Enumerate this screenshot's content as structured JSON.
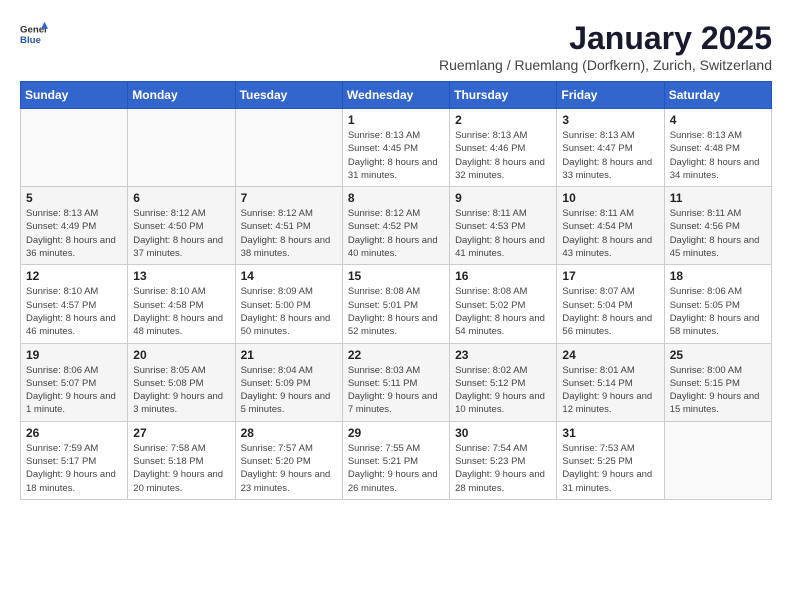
{
  "header": {
    "logo_general": "General",
    "logo_blue": "Blue",
    "title": "January 2025",
    "subtitle": "Ruemlang / Ruemlang (Dorfkern), Zurich, Switzerland"
  },
  "days_of_week": [
    "Sunday",
    "Monday",
    "Tuesday",
    "Wednesday",
    "Thursday",
    "Friday",
    "Saturday"
  ],
  "weeks": [
    [
      {
        "day": "",
        "info": ""
      },
      {
        "day": "",
        "info": ""
      },
      {
        "day": "",
        "info": ""
      },
      {
        "day": "1",
        "info": "Sunrise: 8:13 AM\nSunset: 4:45 PM\nDaylight: 8 hours and 31 minutes."
      },
      {
        "day": "2",
        "info": "Sunrise: 8:13 AM\nSunset: 4:46 PM\nDaylight: 8 hours and 32 minutes."
      },
      {
        "day": "3",
        "info": "Sunrise: 8:13 AM\nSunset: 4:47 PM\nDaylight: 8 hours and 33 minutes."
      },
      {
        "day": "4",
        "info": "Sunrise: 8:13 AM\nSunset: 4:48 PM\nDaylight: 8 hours and 34 minutes."
      }
    ],
    [
      {
        "day": "5",
        "info": "Sunrise: 8:13 AM\nSunset: 4:49 PM\nDaylight: 8 hours and 36 minutes."
      },
      {
        "day": "6",
        "info": "Sunrise: 8:12 AM\nSunset: 4:50 PM\nDaylight: 8 hours and 37 minutes."
      },
      {
        "day": "7",
        "info": "Sunrise: 8:12 AM\nSunset: 4:51 PM\nDaylight: 8 hours and 38 minutes."
      },
      {
        "day": "8",
        "info": "Sunrise: 8:12 AM\nSunset: 4:52 PM\nDaylight: 8 hours and 40 minutes."
      },
      {
        "day": "9",
        "info": "Sunrise: 8:11 AM\nSunset: 4:53 PM\nDaylight: 8 hours and 41 minutes."
      },
      {
        "day": "10",
        "info": "Sunrise: 8:11 AM\nSunset: 4:54 PM\nDaylight: 8 hours and 43 minutes."
      },
      {
        "day": "11",
        "info": "Sunrise: 8:11 AM\nSunset: 4:56 PM\nDaylight: 8 hours and 45 minutes."
      }
    ],
    [
      {
        "day": "12",
        "info": "Sunrise: 8:10 AM\nSunset: 4:57 PM\nDaylight: 8 hours and 46 minutes."
      },
      {
        "day": "13",
        "info": "Sunrise: 8:10 AM\nSunset: 4:58 PM\nDaylight: 8 hours and 48 minutes."
      },
      {
        "day": "14",
        "info": "Sunrise: 8:09 AM\nSunset: 5:00 PM\nDaylight: 8 hours and 50 minutes."
      },
      {
        "day": "15",
        "info": "Sunrise: 8:08 AM\nSunset: 5:01 PM\nDaylight: 8 hours and 52 minutes."
      },
      {
        "day": "16",
        "info": "Sunrise: 8:08 AM\nSunset: 5:02 PM\nDaylight: 8 hours and 54 minutes."
      },
      {
        "day": "17",
        "info": "Sunrise: 8:07 AM\nSunset: 5:04 PM\nDaylight: 8 hours and 56 minutes."
      },
      {
        "day": "18",
        "info": "Sunrise: 8:06 AM\nSunset: 5:05 PM\nDaylight: 8 hours and 58 minutes."
      }
    ],
    [
      {
        "day": "19",
        "info": "Sunrise: 8:06 AM\nSunset: 5:07 PM\nDaylight: 9 hours and 1 minute."
      },
      {
        "day": "20",
        "info": "Sunrise: 8:05 AM\nSunset: 5:08 PM\nDaylight: 9 hours and 3 minutes."
      },
      {
        "day": "21",
        "info": "Sunrise: 8:04 AM\nSunset: 5:09 PM\nDaylight: 9 hours and 5 minutes."
      },
      {
        "day": "22",
        "info": "Sunrise: 8:03 AM\nSunset: 5:11 PM\nDaylight: 9 hours and 7 minutes."
      },
      {
        "day": "23",
        "info": "Sunrise: 8:02 AM\nSunset: 5:12 PM\nDaylight: 9 hours and 10 minutes."
      },
      {
        "day": "24",
        "info": "Sunrise: 8:01 AM\nSunset: 5:14 PM\nDaylight: 9 hours and 12 minutes."
      },
      {
        "day": "25",
        "info": "Sunrise: 8:00 AM\nSunset: 5:15 PM\nDaylight: 9 hours and 15 minutes."
      }
    ],
    [
      {
        "day": "26",
        "info": "Sunrise: 7:59 AM\nSunset: 5:17 PM\nDaylight: 9 hours and 18 minutes."
      },
      {
        "day": "27",
        "info": "Sunrise: 7:58 AM\nSunset: 5:18 PM\nDaylight: 9 hours and 20 minutes."
      },
      {
        "day": "28",
        "info": "Sunrise: 7:57 AM\nSunset: 5:20 PM\nDaylight: 9 hours and 23 minutes."
      },
      {
        "day": "29",
        "info": "Sunrise: 7:55 AM\nSunset: 5:21 PM\nDaylight: 9 hours and 26 minutes."
      },
      {
        "day": "30",
        "info": "Sunrise: 7:54 AM\nSunset: 5:23 PM\nDaylight: 9 hours and 28 minutes."
      },
      {
        "day": "31",
        "info": "Sunrise: 7:53 AM\nSunset: 5:25 PM\nDaylight: 9 hours and 31 minutes."
      },
      {
        "day": "",
        "info": ""
      }
    ]
  ]
}
